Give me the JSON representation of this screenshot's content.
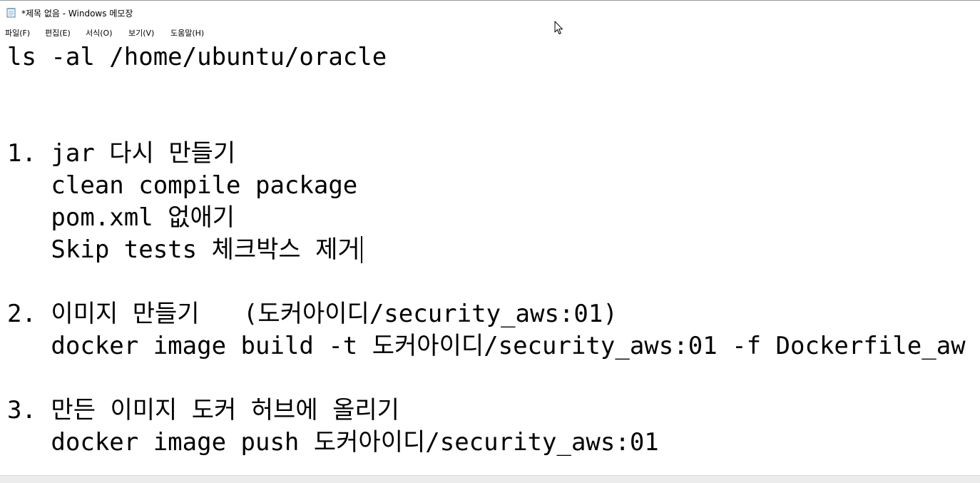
{
  "window": {
    "title": "*제목 없음 - Windows 메모장"
  },
  "menu": {
    "items": [
      {
        "label": "파일(F)"
      },
      {
        "label": "편집(E)"
      },
      {
        "label": "서식(O)"
      },
      {
        "label": "보기(V)"
      },
      {
        "label": "도움말(H)"
      }
    ]
  },
  "editor": {
    "lines": [
      "ls -al /home/ubuntu/oracle",
      "1. jar 다시 만들기",
      "   clean compile package",
      "   pom.xml 없애기",
      "   Skip tests 체크박스 제거",
      "2. 이미지 만들기   (도커아이디/security_aws:01)",
      "   docker image build -t 도커아이디/security_aws:01 -f Dockerfile_aw",
      "3. 만든 이미지 도커 허브에 올리기",
      "   docker image push 도커아이디/security_aws:01"
    ]
  },
  "icons": {
    "app": "notepad-icon",
    "pointer": "mouse-pointer-icon"
  }
}
